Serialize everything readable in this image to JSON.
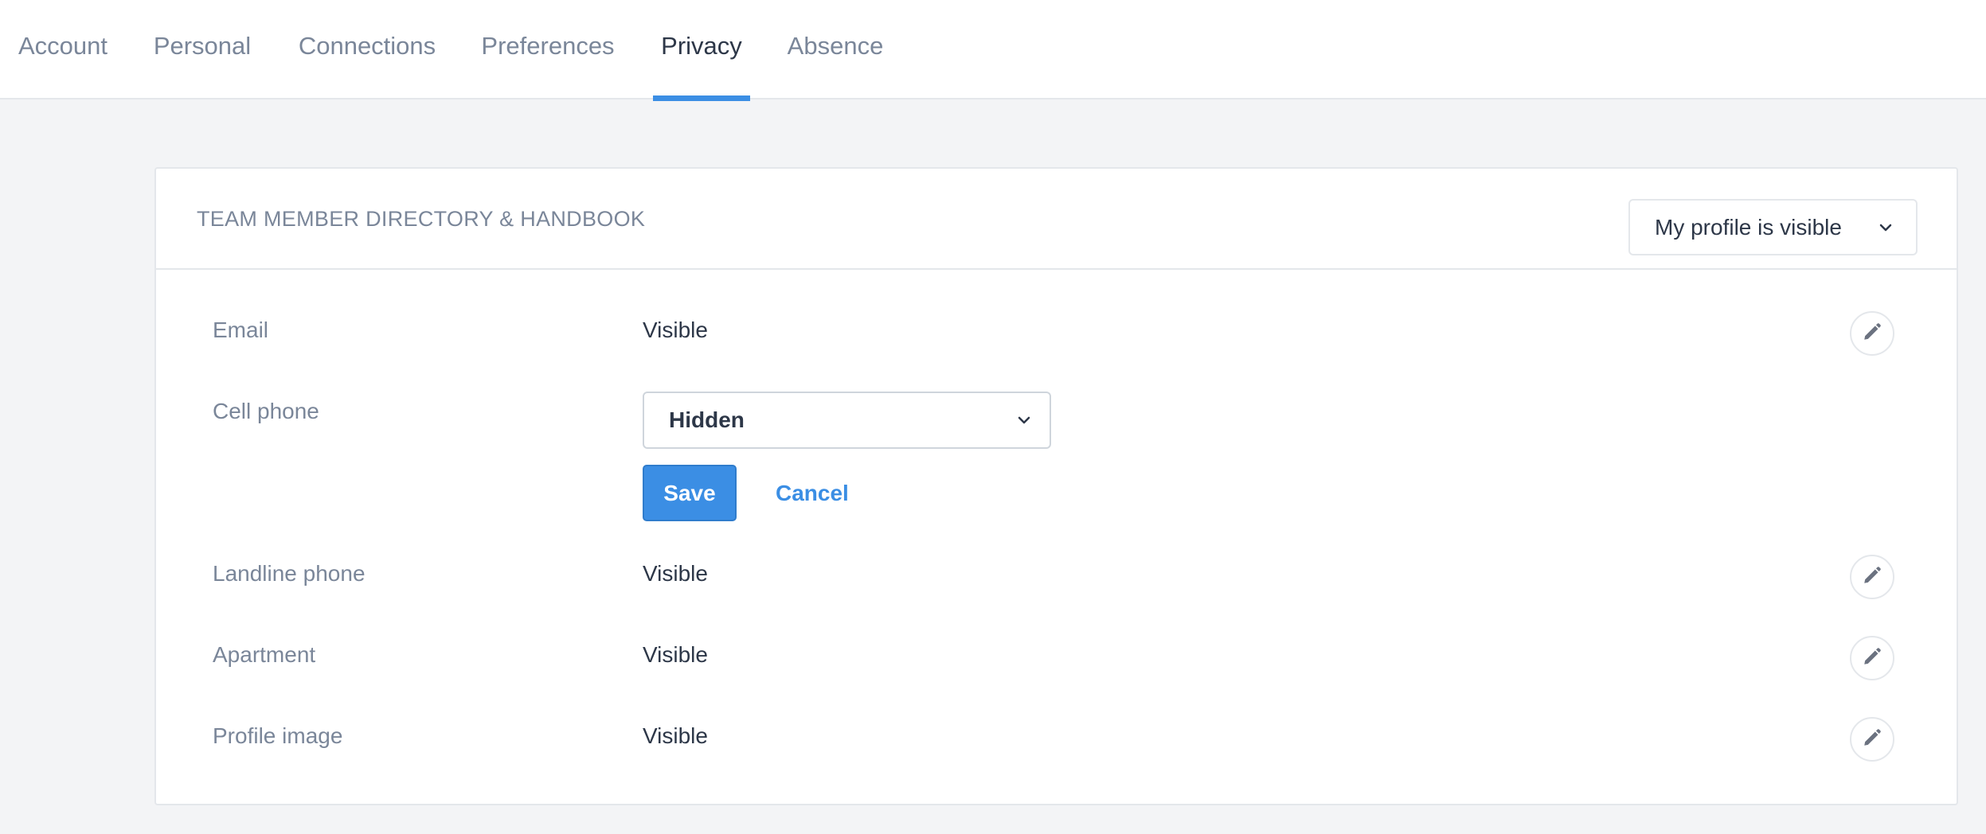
{
  "tabs": [
    {
      "label": "Account"
    },
    {
      "label": "Personal"
    },
    {
      "label": "Connections"
    },
    {
      "label": "Preferences"
    },
    {
      "label": "Privacy",
      "active": true
    },
    {
      "label": "Absence"
    }
  ],
  "card": {
    "title": "TEAM MEMBER DIRECTORY & HANDBOOK",
    "profile_visibility": "My profile is visible"
  },
  "rows": {
    "email": {
      "label": "Email",
      "value": "Visible"
    },
    "cell_phone": {
      "label": "Cell phone",
      "selected": "Hidden"
    },
    "landline": {
      "label": "Landline phone",
      "value": "Visible"
    },
    "apartment": {
      "label": "Apartment",
      "value": "Visible"
    },
    "profile_image": {
      "label": "Profile image",
      "value": "Visible"
    }
  },
  "actions": {
    "save_label": "Save",
    "cancel_label": "Cancel"
  },
  "icons": {
    "edit": "pencil-icon",
    "dropdown": "chevron-down-icon"
  },
  "colors": {
    "accent": "#3b8ee4",
    "muted_text": "#7a8699",
    "text": "#2d3748",
    "background": "#f3f4f6"
  }
}
